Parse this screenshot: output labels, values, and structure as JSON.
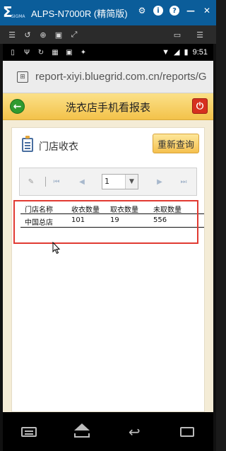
{
  "emulator": {
    "title": "ALPS-N7000R (精简版)",
    "logo": "SIGMA"
  },
  "status_bar": {
    "time": "9:51"
  },
  "browser": {
    "url": "report-xiyi.bluegrid.com.cn/reports/G"
  },
  "header": {
    "title": "洗衣店手机看报表"
  },
  "section": {
    "title": "门店收衣",
    "requery_label": "重新查询"
  },
  "pager": {
    "page_value": "1"
  },
  "table": {
    "columns": [
      "门店名称",
      "收衣数量",
      "取衣数量",
      "未取数量"
    ],
    "rows": [
      [
        "中国总店",
        "101",
        "19",
        "556"
      ]
    ]
  },
  "colors": {
    "emulator_bar": "#0b5d9a",
    "header_gradient": "#f3c24a",
    "highlight_border": "#e13a32",
    "back_button": "#2f9a2f",
    "power_button": "#d6301f"
  }
}
